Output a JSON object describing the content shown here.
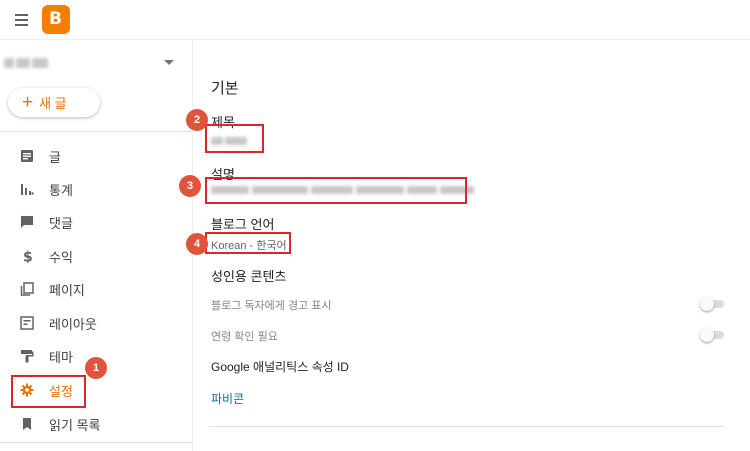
{
  "topbar": {
    "menu_icon": "hamburger-menu-icon",
    "logo_letter": "B",
    "logo_color": "#f57d00"
  },
  "sidebar": {
    "new_post": {
      "icon": "+",
      "label": "새 글"
    },
    "items": [
      {
        "label": "글",
        "icon": "posts-icon"
      },
      {
        "label": "통계",
        "icon": "stats-icon"
      },
      {
        "label": "댓글",
        "icon": "comments-icon"
      },
      {
        "label": "수익",
        "icon": "dollar-icon"
      },
      {
        "label": "페이지",
        "icon": "pages-icon"
      },
      {
        "label": "레이아웃",
        "icon": "layout-icon"
      },
      {
        "label": "테마",
        "icon": "theme-roller-icon"
      },
      {
        "label": "설정",
        "icon": "gear-icon"
      },
      {
        "label": "읽기 목록",
        "icon": "bookmark-icon"
      }
    ]
  },
  "main": {
    "section_title": "기본",
    "title_label": "제목",
    "description_label": "설명",
    "language_label": "블로그 언어",
    "language_value": "Korean - 한국어",
    "adult_content_label": "성인용 콘텐츠",
    "reader_warning_label": "블로그 독자에게 경고 표시",
    "reader_warning_on": false,
    "age_check_label": "연령 확인 필요",
    "age_check_on": false,
    "analytics_label": "Google 애널리틱스 속성 ID",
    "favicon_link": "파비콘"
  },
  "annotations": {
    "badges": [
      "1",
      "2",
      "3",
      "4"
    ],
    "highlight_color": "#d9272e",
    "badge_color": "#e0533d"
  },
  "accent_color": "#e8710a"
}
